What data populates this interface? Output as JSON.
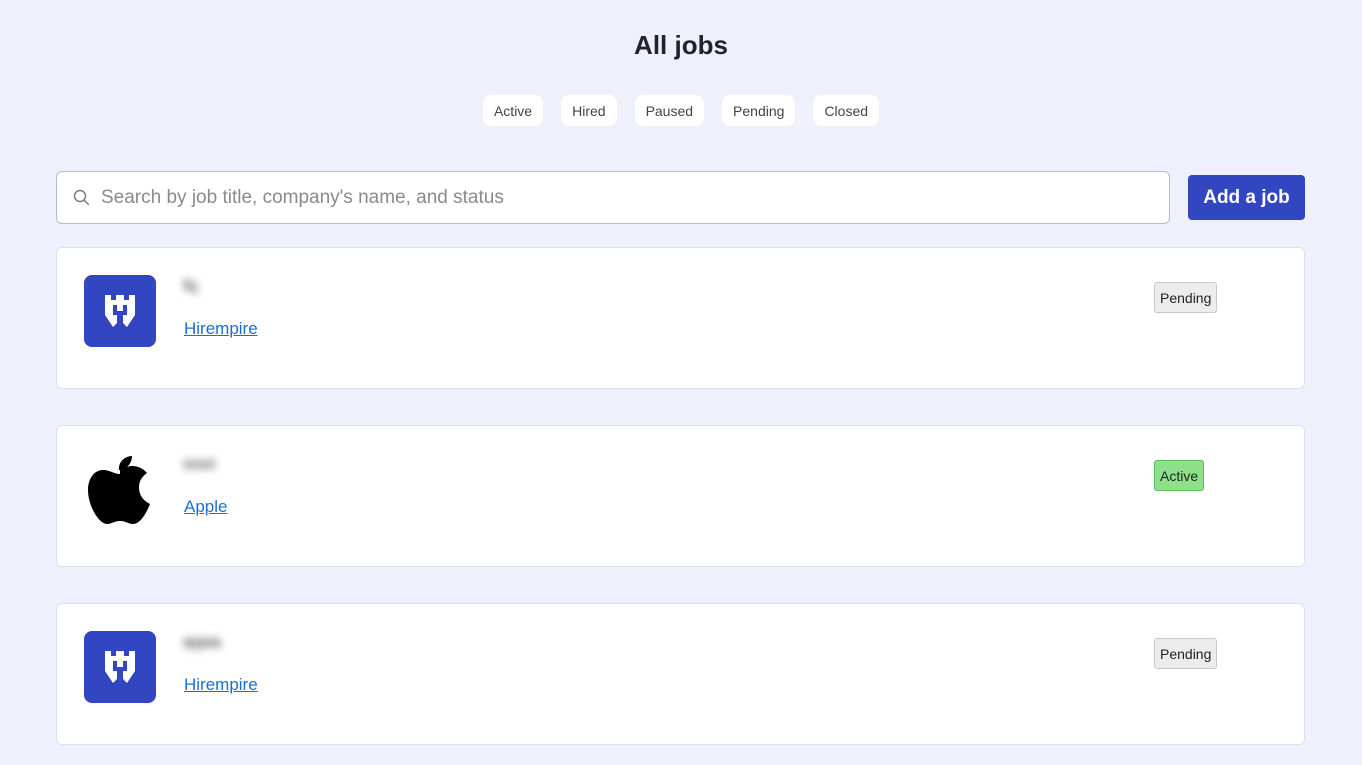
{
  "header": {
    "title": "All jobs"
  },
  "filters": [
    "Active",
    "Hired",
    "Paused",
    "Pending",
    "Closed"
  ],
  "search": {
    "placeholder": "Search by job title, company's name, and status",
    "value": ""
  },
  "actions": {
    "add_job_label": "Add a job"
  },
  "jobs": [
    {
      "title": "fq",
      "company": "Hirempire",
      "status": "Pending",
      "logo_icon": "hirempire-logo-icon"
    },
    {
      "title": "oooi",
      "company": "Apple",
      "status": "Active",
      "logo_icon": "apple-logo-icon"
    },
    {
      "title": "qqaa",
      "company": "Hirempire",
      "status": "Pending",
      "logo_icon": "hirempire-logo-icon"
    }
  ],
  "colors": {
    "brand": "#3346c2",
    "link": "#1a6fd4",
    "active": "#8ee08a",
    "pending": "#ececec",
    "background": "#eef0fb"
  }
}
